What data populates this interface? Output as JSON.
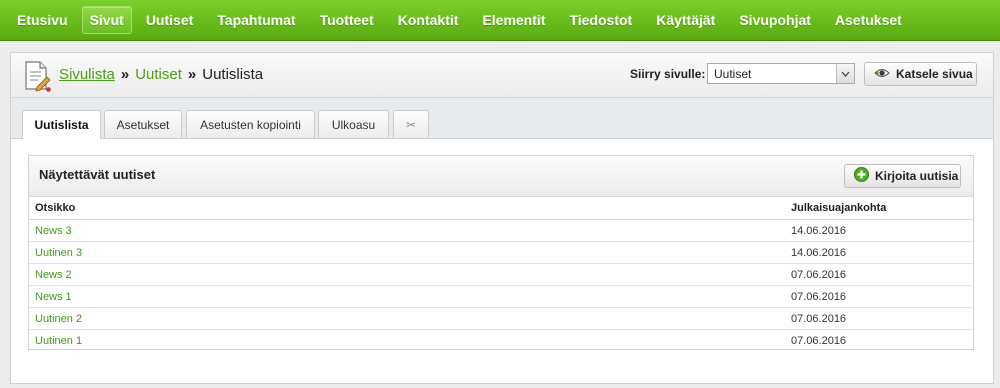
{
  "nav": {
    "items": [
      {
        "label": "Etusivu",
        "active": false
      },
      {
        "label": "Sivut",
        "active": true
      },
      {
        "label": "Uutiset",
        "active": false
      },
      {
        "label": "Tapahtumat",
        "active": false
      },
      {
        "label": "Tuotteet",
        "active": false
      },
      {
        "label": "Kontaktit",
        "active": false
      },
      {
        "label": "Elementit",
        "active": false
      },
      {
        "label": "Tiedostot",
        "active": false
      },
      {
        "label": "Käyttäjät",
        "active": false
      },
      {
        "label": "Sivupohjat",
        "active": false
      },
      {
        "label": "Asetukset",
        "active": false
      }
    ]
  },
  "breadcrumb": {
    "first": "Sivulista",
    "second": "Uutiset",
    "current": "Uutislista",
    "separator": "»"
  },
  "goto": {
    "label": "Siirry sivulle:",
    "selected": "Uutiset"
  },
  "view_button": "Katsele sivua",
  "tabs": [
    {
      "label": "Uutislista",
      "active": true
    },
    {
      "label": "Asetukset",
      "active": false
    },
    {
      "label": "Asetusten kopiointi",
      "active": false
    },
    {
      "label": "Ulkoasu",
      "active": false
    },
    {
      "label": "✂",
      "active": false
    }
  ],
  "news_box": {
    "title": "Näytettävät uutiset",
    "write_button": "Kirjoita uutisia",
    "columns": {
      "title": "Otsikko",
      "date": "Julkaisuajankohta"
    },
    "rows": [
      {
        "title": "News 3",
        "date": "14.06.2016"
      },
      {
        "title": "Uutinen 3",
        "date": "14.06.2016"
      },
      {
        "title": "News 2",
        "date": "07.06.2016"
      },
      {
        "title": "News 1",
        "date": "07.06.2016"
      },
      {
        "title": "Uutinen 2",
        "date": "07.06.2016"
      },
      {
        "title": "Uutinen 1",
        "date": "07.06.2016"
      }
    ]
  },
  "colors": {
    "nav_green": "#6cbd22",
    "link_green": "#3e9c10"
  }
}
